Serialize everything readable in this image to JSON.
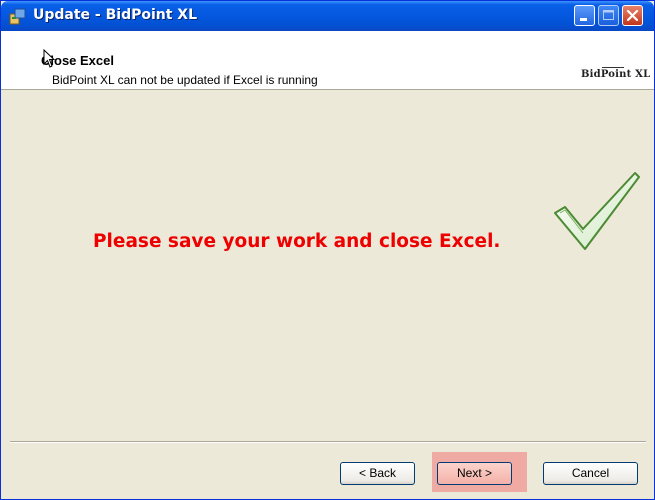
{
  "window": {
    "title": "Update - BidPoint XL",
    "title_icon": "installer-icon",
    "controls": [
      "minimize-icon",
      "maximize-icon",
      "close-icon"
    ]
  },
  "header": {
    "title": "Close Excel",
    "subtitle": "BidPoint XL can not be updated if Excel is running",
    "logo_text": "BidPoint XL"
  },
  "main": {
    "message": "Please save your work and close Excel.",
    "message_color": "#ee0000",
    "check_icon": "checkmark-icon"
  },
  "buttons": {
    "back_label": "< Back",
    "next_label": "Next >",
    "cancel_label": "Cancel"
  },
  "colors": {
    "titlebar": "#0559e0",
    "close": "#c2361a",
    "highlight": "#f0a09a"
  }
}
